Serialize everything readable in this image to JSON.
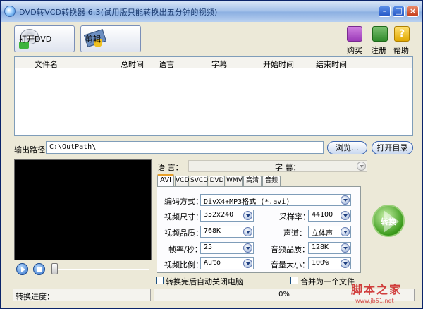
{
  "window": {
    "title": "DVD转VCD转换器 6.3(试用版只能转换出五分钟的视频)"
  },
  "toolbar": {
    "open_dvd": "打开DVD",
    "edit": "剪辑",
    "buy": "购买",
    "register": "注册",
    "help": "帮助",
    "help_glyph": "?"
  },
  "file_list": {
    "columns": [
      "文件名",
      "总时间",
      "语言",
      "字幕",
      "开始时间",
      "结束时间"
    ]
  },
  "output": {
    "label": "输出路径：",
    "path": "C:\\OutPath\\",
    "browse": "浏览...",
    "open_dir": "打开目录"
  },
  "media": {
    "language_label": "语 言：",
    "subtitle_label": "字 幕："
  },
  "tabs": [
    "AVI",
    "VCD",
    "SVCD",
    "DVD",
    "WMV",
    "高清",
    "音频"
  ],
  "settings": {
    "codec_label": "编码方式：",
    "codec_value": "DivX4+MP3格式 (*.avi)",
    "size_label": "视频尺寸：",
    "size_value": "352x240",
    "quality_label": "视频品质：",
    "quality_value": "768K",
    "fps_label": "帧率/秒：",
    "fps_value": "25",
    "aspect_label": "视频比例：",
    "aspect_value": "Auto",
    "samplerate_label": "采样率：",
    "samplerate_value": "44100",
    "channel_label": "声道：",
    "channel_value": "立体声",
    "audioquality_label": "音频品质：",
    "audioquality_value": "128K",
    "volume_label": "音量大小：",
    "volume_value": "100%"
  },
  "actions": {
    "convert": "转换",
    "shutdown_label": "转换完后自动关闭电脑",
    "merge_label": "合并为一个文件"
  },
  "status": {
    "progress_label": "转换进度：",
    "progress_value": "0%"
  },
  "watermark": {
    "logo": "脚本之家",
    "url": "www.jb51.net"
  }
}
